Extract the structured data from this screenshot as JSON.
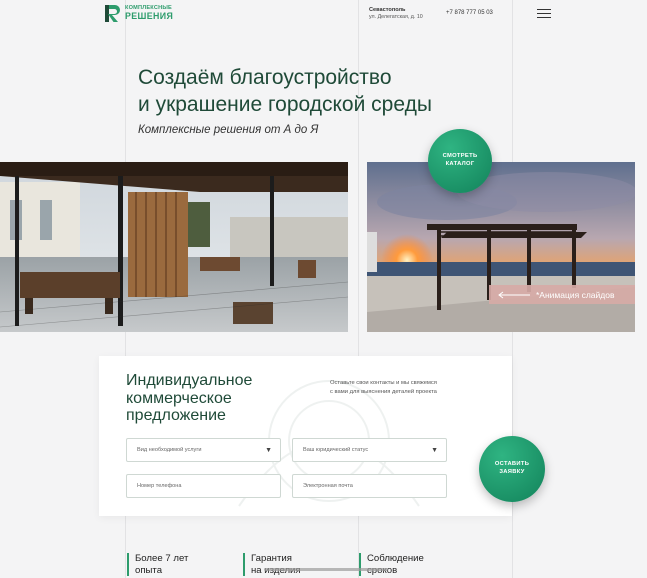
{
  "header": {
    "logo_line1": "КОМПЛЕКСНЫЕ",
    "logo_line2": "РЕШЕНИЯ",
    "city": "Севастополь",
    "address": "ул. Делегатская, д. 10",
    "phone": "+7 878 777 05 03",
    "menu_icon": "hamburger-icon"
  },
  "hero": {
    "title_line1": "Создаём благоустройство",
    "title_line2": "и украшение городской среды",
    "subtitle": "Комплексные решения от А до Я",
    "catalog_line1": "СМОТРЕТЬ",
    "catalog_line2": "КАТАЛОГ",
    "slider_note": "*Анимация слайдов"
  },
  "form": {
    "title_line1": "Индивидуальное",
    "title_line2": "коммерческое",
    "title_line3": "предложение",
    "note": "Оставьте свои контакты и мы свяжемся с вами для выяснения деталей проекта",
    "service_placeholder": "Вид необходимой услуги",
    "status_placeholder": "Ваш юридический статус",
    "phone_placeholder": "Номер телефона",
    "email_placeholder": "Электронная почта",
    "submit_line1": "ОСТАВИТЬ",
    "submit_line2": "ЗАЯВКУ"
  },
  "features": [
    {
      "line1": "Более 7 лет",
      "line2": "опыта"
    },
    {
      "line1": "Гарантия",
      "line2": "на изделия"
    },
    {
      "line1": "Соблюдение",
      "line2": "сроков"
    }
  ],
  "colors": {
    "accent": "#2d9c6c",
    "title": "#1f4a38",
    "slider_tag": "#d6aaa6"
  }
}
